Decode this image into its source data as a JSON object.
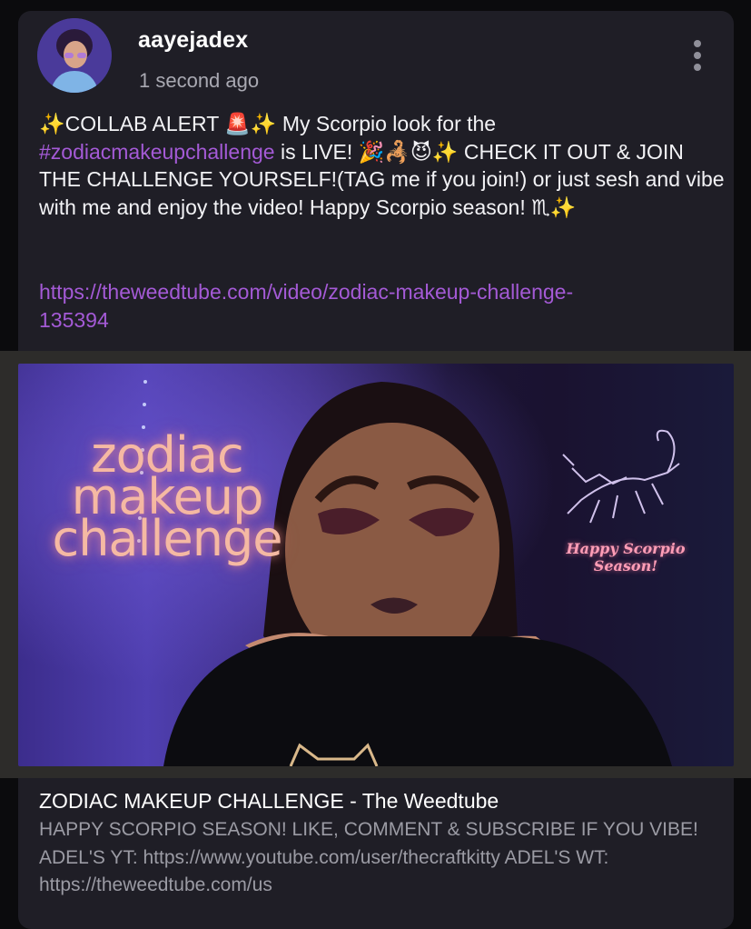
{
  "post": {
    "author": "aayejadex",
    "timestamp": "1 second ago",
    "text_part1": "✨COLLAB ALERT 🚨✨ My Scorpio look for the ",
    "hashtag": "#zodiacmakeupchallenge",
    "text_part2": " is LIVE! 🎉🦂😈✨ CHECK IT OUT & JOIN THE CHALLENGE YOURSELF!(TAG me if you join!) or just sesh and vibe with me and enjoy the video! Happy Scorpio season! ♏✨",
    "link": "https://theweedtube.com/video/zodiac-makeup-challenge-135394"
  },
  "preview": {
    "thumbnail_text": "zodiac makeup challenge",
    "thumbnail_script": "Happy Scorpio Season!",
    "title": "ZODIAC MAKEUP CHALLENGE - The Weedtube",
    "description": "HAPPY SCORPIO SEASON! LIKE, COMMENT & SUBSCRIBE IF YOU VIBE! ADEL'S YT: https://www.youtube.com/user/thecraftkitty ADEL'S WT: https://theweedtube.com/us"
  },
  "icons": {
    "more": "more-vertical-icon"
  },
  "colors": {
    "card_bg": "#1f1e26",
    "accent": "#a45ad6",
    "muted": "#9b9ba4"
  }
}
